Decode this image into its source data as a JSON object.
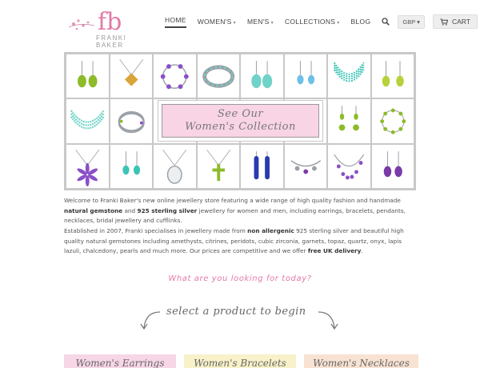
{
  "header": {
    "logo_mark": "fb",
    "logo_text": "FRANKI BAKER",
    "nav": [
      {
        "label": "HOME",
        "active": true,
        "caret": false
      },
      {
        "label": "WOMEN'S",
        "active": false,
        "caret": true
      },
      {
        "label": "MEN'S",
        "active": false,
        "caret": true
      },
      {
        "label": "COLLECTIONS",
        "active": false,
        "caret": true
      },
      {
        "label": "BLOG",
        "active": false,
        "caret": false
      }
    ],
    "currency": "GBP",
    "cart_label": "CART",
    "accent_color": "#e27aa7"
  },
  "banner": {
    "callout_line1": "See Our",
    "callout_line2": "Women's Collection",
    "callout_bg": "#f8d4e5",
    "items": [
      "green-drop-earrings",
      "citrine-pendant",
      "amethyst-bracelet",
      "turquoise-bracelet",
      "turquoise-drop-earrings",
      "blue-topaz-earrings",
      "multi-strand-necklace",
      "green-heart-earrings",
      "peridot-beaded-necklace",
      "silver-bangles",
      "",
      "",
      "",
      "",
      "peridot-flower-earrings",
      "green-stone-bracelet",
      "amethyst-flower-pendant",
      "turquoise-earrings",
      "filigree-pendant",
      "peridot-cross-pendant",
      "lapis-drop-earrings",
      "charm-bracelet",
      "amethyst-collar-necklace",
      "purple-drop-earrings"
    ]
  },
  "intro": {
    "p1_a": "Welcome to Franki Baker's new online jewellery store featuring a wide range of high quality fashion and handmade ",
    "p1_b": "natural gemstone",
    "p1_c": " and ",
    "p1_d": "925 sterling silver",
    "p1_e": " jewellery for women and men, including earrings, bracelets, pendants, necklaces, bridal jewellery and cufflinks.",
    "p2_a": "Established in 2007, Franki specialises in jewellery made from ",
    "p2_b": "non allergenic",
    "p2_c": " 925 sterling silver and beautiful high quality natural gemstones including amethysts, citrines, peridots, cubic zirconia, garnets, topaz, quartz, onyx, lapis lazuli, chalcedony, pearls and much more. Our prices are competitive and we offer ",
    "p2_d": "free UK delivery",
    "p2_e": "."
  },
  "question": "What are you looking for today?",
  "select_prompt": "select a product to begin",
  "categories": [
    {
      "label": "Women's Earrings",
      "color": "#f7d6e6"
    },
    {
      "label": "Women's Bracelets",
      "color": "#f8f1c9"
    },
    {
      "label": "Women's Necklaces",
      "color": "#f8e2d2"
    }
  ]
}
